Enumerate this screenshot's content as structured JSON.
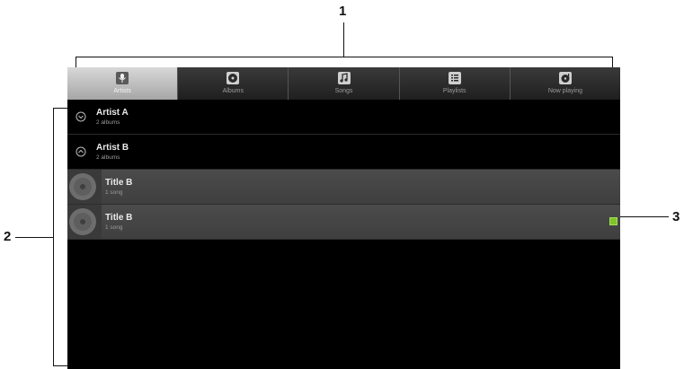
{
  "callouts": {
    "one": "1",
    "two": "2",
    "three": "3"
  },
  "tabs": [
    {
      "label": "Artists",
      "icon": "microphone-icon",
      "active": true
    },
    {
      "label": "Albums",
      "icon": "album-icon",
      "active": false
    },
    {
      "label": "Songs",
      "icon": "music-note-icon",
      "active": false
    },
    {
      "label": "Playlists",
      "icon": "playlist-icon",
      "active": false
    },
    {
      "label": "Now playing",
      "icon": "now-playing-icon",
      "active": false
    }
  ],
  "artists": [
    {
      "name": "Artist A",
      "count": "2 albums",
      "expanded": false
    },
    {
      "name": "Artist B",
      "count": "2 albums",
      "expanded": true
    }
  ],
  "songs": [
    {
      "title": "Title B",
      "count": "1 song",
      "playing": false
    },
    {
      "title": "Title B",
      "count": "1 song",
      "playing": true
    }
  ],
  "colors": {
    "playing_indicator": "#7ec42a",
    "tab_active": "#bdbdbd",
    "background": "#000000"
  }
}
